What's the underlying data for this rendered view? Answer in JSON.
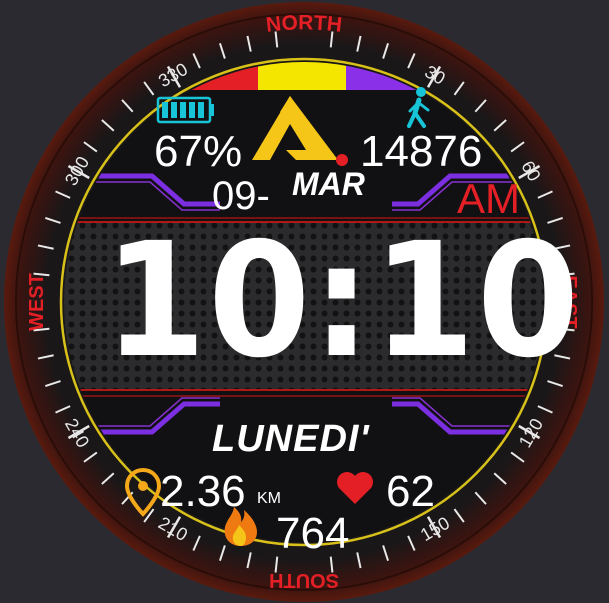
{
  "compass": {
    "north": "NORTH",
    "south": "SOUTH",
    "east": "EAST",
    "west": "WEST",
    "degrees": [
      "30",
      "60",
      "120",
      "150",
      "210",
      "240",
      "300",
      "330"
    ]
  },
  "status": {
    "battery_percent": "67%",
    "steps": "14876"
  },
  "date": {
    "day_number": "09-",
    "month": "MAR",
    "ampm": "AM",
    "weekday": "LUNEDI'"
  },
  "time": "10:10",
  "stats": {
    "distance": "2.36",
    "distance_unit": "KM",
    "heart_rate": "62",
    "calories": "764"
  },
  "colors": {
    "accent_red": "#e41f26",
    "accent_yellow": "#f5c518",
    "accent_purple": "#7b2fe0",
    "accent_cyan": "#18c4d8",
    "ring_yellow": "#d8c21a"
  },
  "icons": {
    "battery": "battery-icon",
    "steps": "walking-person-icon",
    "logo": "brand-logo-a-icon",
    "location": "location-pin-icon",
    "heart": "heart-icon",
    "calories": "flame-icon"
  }
}
